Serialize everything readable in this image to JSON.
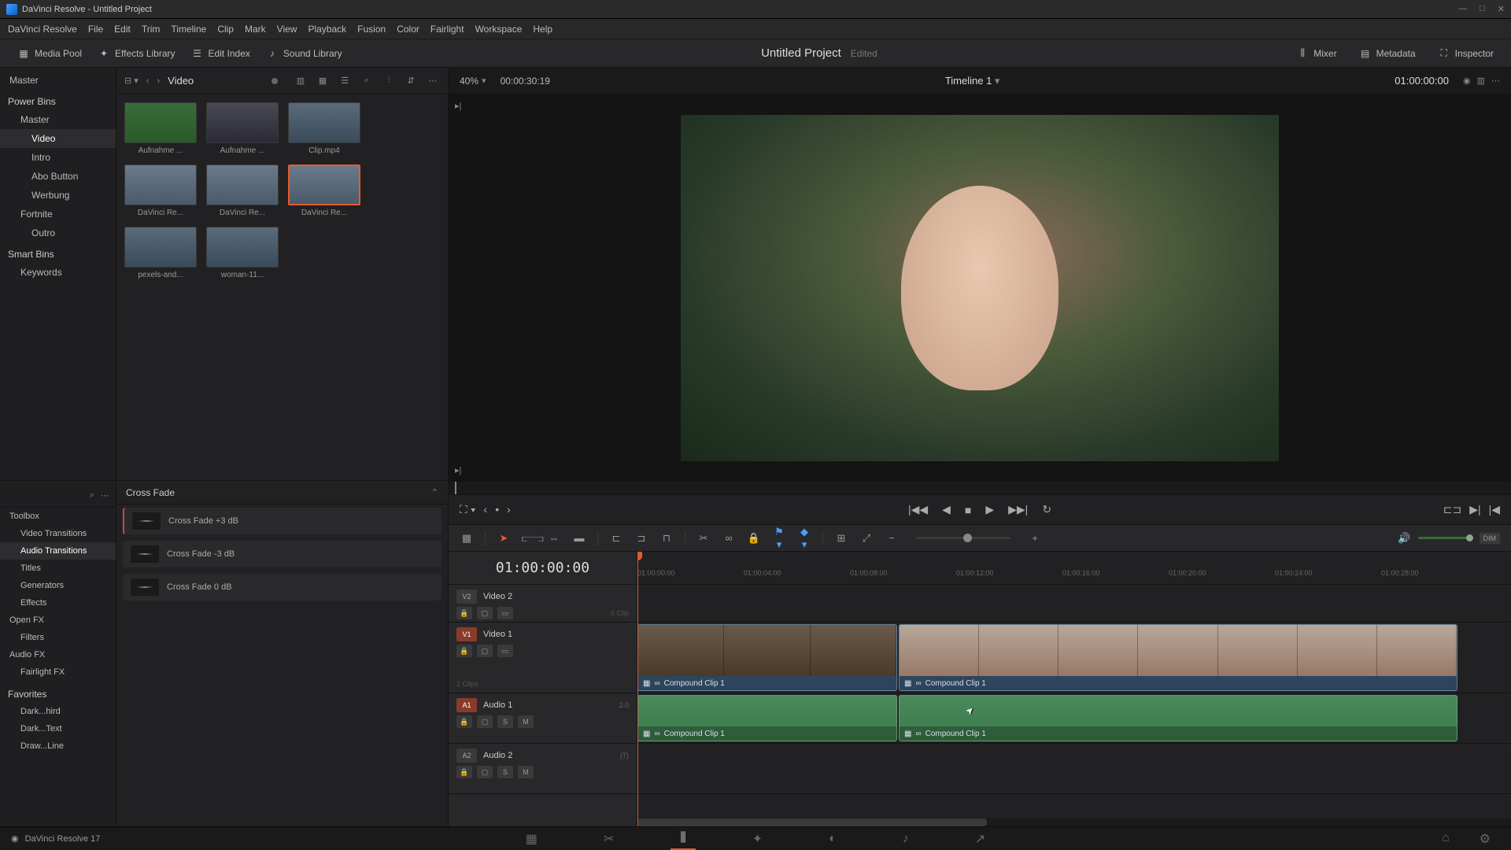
{
  "titlebar": {
    "text": "DaVinci Resolve - Untitled Project"
  },
  "menubar": [
    "DaVinci Resolve",
    "File",
    "Edit",
    "Trim",
    "Timeline",
    "Clip",
    "Mark",
    "View",
    "Playback",
    "Fusion",
    "Color",
    "Fairlight",
    "Workspace",
    "Help"
  ],
  "toolbar": {
    "media_pool": "Media Pool",
    "effects_library": "Effects Library",
    "edit_index": "Edit Index",
    "sound_library": "Sound Library",
    "mixer": "Mixer",
    "metadata": "Metadata",
    "inspector": "Inspector",
    "project_title": "Untitled Project",
    "project_status": "Edited"
  },
  "bins": {
    "master": "Master",
    "power_bins": "Power Bins",
    "items": [
      "Master",
      "Video",
      "Intro",
      "Abo Button",
      "Werbung",
      "Fortnite",
      "Outro"
    ],
    "smart_bins": "Smart Bins",
    "keywords": "Keywords"
  },
  "media": {
    "folder": "Video",
    "clips": [
      {
        "label": "Aufnahme ...",
        "style": "green"
      },
      {
        "label": "Aufnahme ...",
        "style": "dark"
      },
      {
        "label": "Clip.mp4",
        "style": "person"
      },
      {
        "label": "DaVinci Re...",
        "style": "river"
      },
      {
        "label": "DaVinci Re...",
        "style": "river"
      },
      {
        "label": "DaVinci Re...",
        "style": "river",
        "selected": true
      },
      {
        "label": "pexels-and...",
        "style": "person"
      },
      {
        "label": "woman-11...",
        "style": "person"
      }
    ]
  },
  "fx_tree": {
    "toolbox": "Toolbox",
    "items": [
      "Video Transitions",
      "Audio Transitions",
      "Titles",
      "Generators",
      "Effects"
    ],
    "open_fx": "Open FX",
    "filters": "Filters",
    "audio_fx": "Audio FX",
    "fairlight_fx": "Fairlight FX",
    "favorites": "Favorites",
    "fav_items": [
      "Dark...hird",
      "Dark...Text",
      "Draw...Line"
    ]
  },
  "fx_list": {
    "category": "Cross Fade",
    "entries": [
      "Cross Fade +3 dB",
      "Cross Fade -3 dB",
      "Cross Fade 0 dB"
    ]
  },
  "viewer": {
    "zoom": "40%",
    "tc_left": "00:00:30:19",
    "timeline_name": "Timeline 1",
    "tc_right": "01:00:00:00"
  },
  "timeline": {
    "tc_display": "01:00:00:00",
    "ruler_ticks": [
      "01:00:00:00",
      "01:00:04:00",
      "01:00:08:00",
      "01:00:12:00",
      "01:00:16:00",
      "01:00:20:00",
      "01:00:24:00",
      "01:00:28:00"
    ],
    "tracks": {
      "v2": {
        "badge": "V2",
        "name": "Video 2",
        "clips_text": "0 Clip"
      },
      "v1": {
        "badge": "V1",
        "name": "Video 1",
        "clips_text": "2 Clips"
      },
      "a1": {
        "badge": "A1",
        "name": "Audio 1",
        "meta": "2.0"
      },
      "a2": {
        "badge": "A2",
        "name": "Audio 2",
        "meta": "(7)"
      }
    },
    "clip1_name": "Compound Clip 1",
    "clip2_name": "Compound Clip 1",
    "solo": "S",
    "mute": "M",
    "dim": "DIM"
  },
  "footer": {
    "version": "DaVinci Resolve 17"
  }
}
